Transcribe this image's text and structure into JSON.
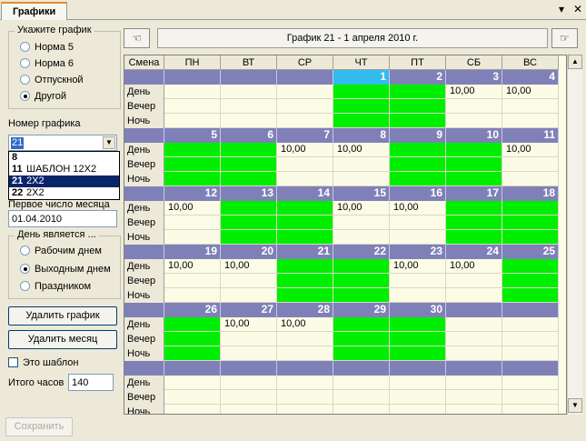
{
  "tab": {
    "title": "Графики",
    "nav_arrow": "▾",
    "close": "✕"
  },
  "schedule_group": {
    "title": "Укажите график",
    "options": [
      "Норма 5",
      "Норма 6",
      "Отпускной",
      "Другой"
    ],
    "selected": 3
  },
  "schedule_number": {
    "label": "Номер графика",
    "value": "21",
    "dropdown": [
      {
        "num": "8",
        "name": ""
      },
      {
        "num": "11",
        "name": "ШАБЛОН 12Х2"
      },
      {
        "num": "21",
        "name": "2Х2"
      },
      {
        "num": "22",
        "name": "2Х2"
      }
    ],
    "dropdown_selected": 2
  },
  "first_day": {
    "label": "Первое число месяца",
    "value": "01.04.2010"
  },
  "day_group": {
    "title": "День является ...",
    "options": [
      "Рабочим днем",
      "Выходным днем",
      "Праздником"
    ],
    "selected": 1
  },
  "buttons": {
    "delete_schedule": "Удалить график",
    "delete_month": "Удалить месяц",
    "save": "Сохранить"
  },
  "template_checkbox": {
    "label": "Это шаблон",
    "checked": false
  },
  "total_hours": {
    "label": "Итого часов",
    "value": "140"
  },
  "calendar": {
    "title": "График 21 - 1 апреля 2010 г.",
    "shift_header": "Смена",
    "weekdays": [
      "ПН",
      "ВТ",
      "СР",
      "ЧТ",
      "ПТ",
      "СБ",
      "ВС"
    ],
    "shifts": [
      "День",
      "Вечер",
      "Ночь"
    ],
    "weeks": [
      {
        "days": [
          "",
          "",
          "",
          "1",
          "2",
          "3",
          "4"
        ],
        "green": [
          false,
          false,
          false,
          true,
          true,
          false,
          false
        ],
        "values": [
          "",
          "",
          "",
          "",
          "",
          "10,00",
          "10,00"
        ]
      },
      {
        "days": [
          "5",
          "6",
          "7",
          "8",
          "9",
          "10",
          "11"
        ],
        "green": [
          true,
          true,
          false,
          false,
          true,
          true,
          false
        ],
        "values": [
          "",
          "",
          "10,00",
          "10,00",
          "",
          "",
          "10,00"
        ]
      },
      {
        "days": [
          "12",
          "13",
          "14",
          "15",
          "16",
          "17",
          "18"
        ],
        "green": [
          false,
          true,
          true,
          false,
          false,
          true,
          true
        ],
        "values": [
          "10,00",
          "",
          "",
          "10,00",
          "10,00",
          "",
          ""
        ]
      },
      {
        "days": [
          "19",
          "20",
          "21",
          "22",
          "23",
          "24",
          "25"
        ],
        "green": [
          false,
          false,
          true,
          true,
          false,
          false,
          true
        ],
        "values": [
          "10,00",
          "10,00",
          "",
          "",
          "10,00",
          "10,00",
          ""
        ]
      },
      {
        "days": [
          "26",
          "27",
          "28",
          "29",
          "30",
          "",
          ""
        ],
        "green": [
          true,
          false,
          false,
          true,
          true,
          false,
          false
        ],
        "values": [
          "",
          "10,00",
          "10,00",
          "",
          "",
          "",
          ""
        ]
      },
      {
        "days": [
          "",
          "",
          "",
          "",
          "",
          "",
          ""
        ],
        "green": [
          false,
          false,
          false,
          false,
          false,
          false,
          false
        ],
        "values": [
          "",
          "",
          "",
          "",
          "",
          "",
          ""
        ]
      }
    ]
  },
  "colors": {
    "work_day": "#00ee00",
    "today_header": "#33bbee",
    "day_header": "#8080b8",
    "cell": "#fbfbe6"
  }
}
